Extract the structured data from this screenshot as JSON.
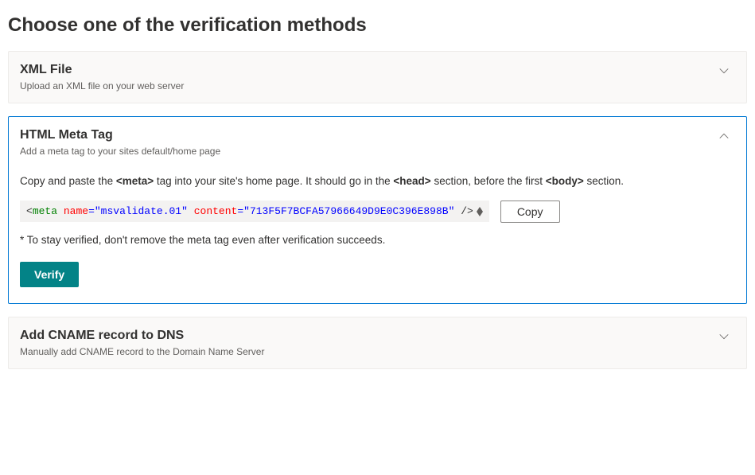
{
  "page": {
    "title": "Choose one of the verification methods"
  },
  "methods": {
    "xml": {
      "title": "XML File",
      "subtitle": "Upload an XML file on your web server"
    },
    "html": {
      "title": "HTML Meta Tag",
      "subtitle": "Add a meta tag to your sites default/home page",
      "instruction_pre": "Copy and paste the ",
      "instruction_tag1": "<meta>",
      "instruction_mid1": " tag into your site's home page. It should go in the ",
      "instruction_tag2": "<head>",
      "instruction_mid2": " section, before the first ",
      "instruction_tag3": "<body>",
      "instruction_post": " section.",
      "code": {
        "open": "<",
        "tag": "meta",
        "sp1": " ",
        "attr1": "name",
        "eq": "=",
        "val1": "\"msvalidate.01\"",
        "sp2": " ",
        "attr2": "content",
        "val2": "\"713F5F7BCFA57966649D9E0C396E898B\"",
        "sp3": " ",
        "close": "/>"
      },
      "copy_label": "Copy",
      "note": "* To stay verified, don't remove the meta tag even after verification succeeds.",
      "verify_label": "Verify"
    },
    "cname": {
      "title": "Add CNAME record to DNS",
      "subtitle": "Manually add CNAME record to the Domain Name Server"
    }
  }
}
